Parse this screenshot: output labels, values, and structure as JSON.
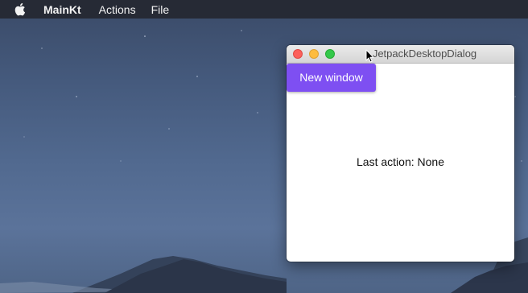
{
  "menubar": {
    "apple_icon": "apple-logo-icon",
    "app_name": "MainKt",
    "items": [
      {
        "label": "Actions"
      },
      {
        "label": "File"
      }
    ]
  },
  "window": {
    "title": "JetpackDesktopDialog",
    "controls": [
      "close",
      "minimize",
      "zoom"
    ],
    "colors": {
      "close": "#fc605b",
      "minimize": "#fdbc40",
      "zoom": "#34c84a"
    },
    "button": {
      "label": "New window",
      "color": "#7e4ff2"
    },
    "status_text": "Last action: None"
  },
  "cursor": "arrow-pointer-icon"
}
